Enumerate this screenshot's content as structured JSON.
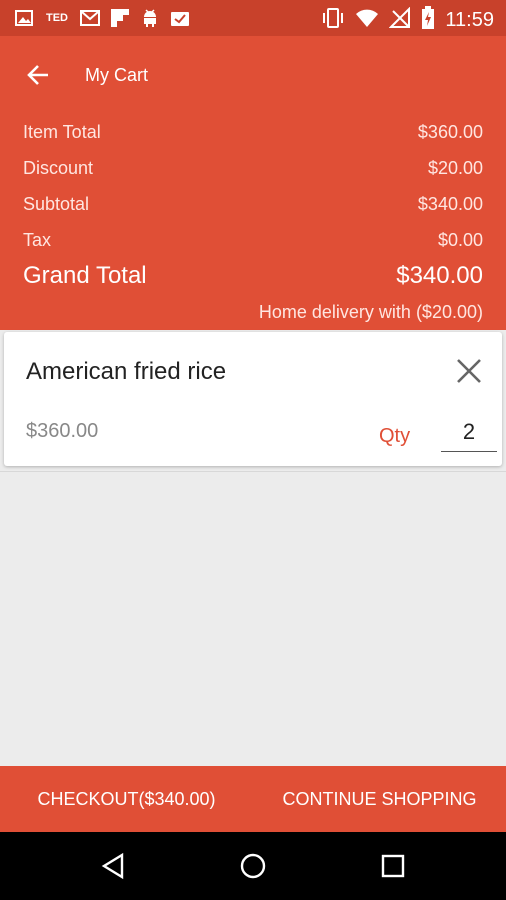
{
  "status_bar": {
    "time": "11:59",
    "left_icons": [
      "image-icon",
      "ted-icon",
      "gmail-icon",
      "flipboard-icon",
      "android-icon",
      "clipboard-check-icon"
    ],
    "right_icons": [
      "vibrate-icon",
      "wifi-icon",
      "no-signal-icon",
      "battery-charging-icon"
    ],
    "ted_text": "TED"
  },
  "app_bar": {
    "title": "My Cart",
    "back_icon": "arrow-back-icon"
  },
  "summary": {
    "item_total_label": "Item Total",
    "item_total_value": "$360.00",
    "discount_label": "Discount",
    "discount_value": "$20.00",
    "subtotal_label": "Subtotal",
    "subtotal_value": "$340.00",
    "tax_label": "Tax",
    "tax_value": "$0.00",
    "grand_total_label": "Grand Total",
    "grand_total_value": "$340.00",
    "delivery_note": "Home delivery with ($20.00)"
  },
  "cart_items": [
    {
      "name": "American fried rice",
      "price": "$360.00",
      "qty_label": "Qty",
      "qty": "2"
    }
  ],
  "actions": {
    "checkout_label": "CHECKOUT($340.00)",
    "continue_label": "CONTINUE SHOPPING"
  },
  "colors": {
    "primary": "#e04f36",
    "status_bar": "#c8412b",
    "accent_text": "#e04f36"
  }
}
